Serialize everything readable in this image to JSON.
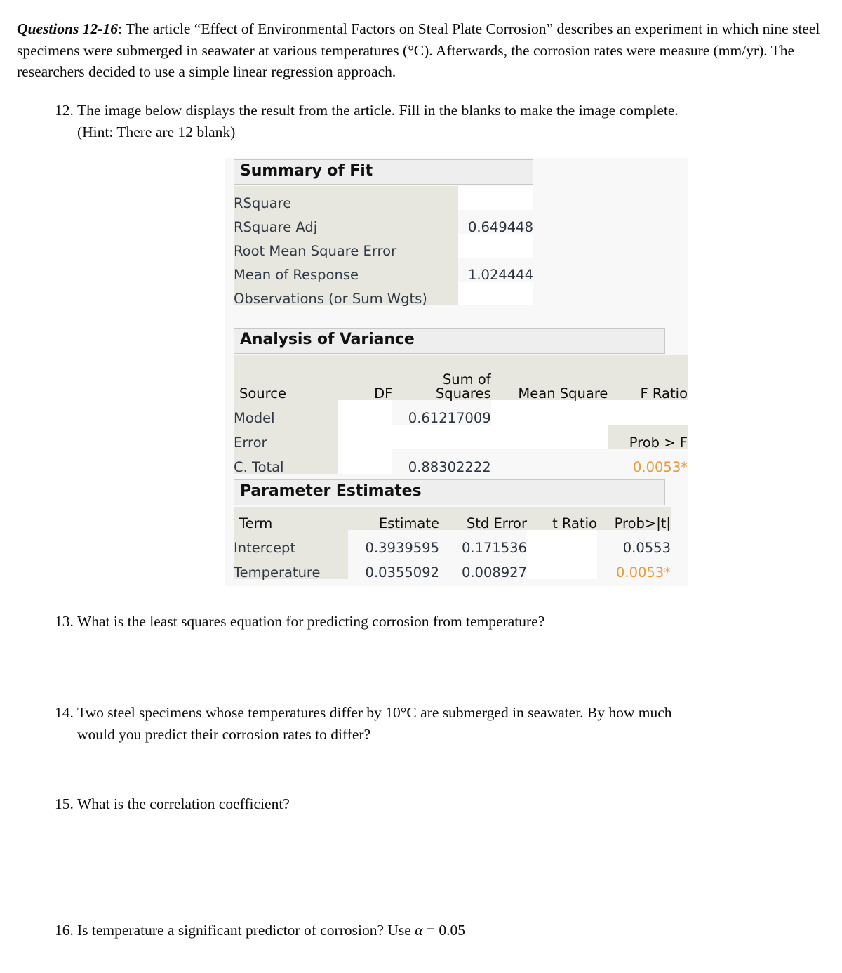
{
  "intro": {
    "lead": "Questions 12-16",
    "text": ": The article “Effect of Environmental Factors on Steal Plate Corrosion” describes an experiment in which nine steel specimens were submerged in seawater at various temperatures (°C). Afterwards, the corrosion rates were measure (mm/yr). The researchers decided to use a simple linear regression approach."
  },
  "questions": [
    {
      "number": "12.",
      "line1": "The image below displays the result from the article. Fill in the blanks to make the image complete.",
      "line2": "(Hint: There are 12 blank)"
    },
    {
      "number": "13.",
      "line1": "What is the least squares equation for predicting corrosion from temperature?",
      "line2": ""
    },
    {
      "number": "14.",
      "line1": "Two steel specimens whose temperatures differ by 10°C are submerged in seawater. By how much",
      "line2": "would you predict their corrosion rates to differ?"
    },
    {
      "number": "15.",
      "line1": "What is the correlation coefficient?",
      "line2": ""
    },
    {
      "number": "16.",
      "line1_pre": "Is temperature a significant predictor of corrosion? Use ",
      "alpha": "α",
      "line1_post": " = 0.05"
    }
  ],
  "report": {
    "colors": {
      "label_bg": "#e7e7e0",
      "header_bg": "#eeeeee",
      "value_text": "#2a3440",
      "significant": "#eb9a37",
      "panel_bg": "#f8f8f8"
    },
    "summary_of_fit": {
      "title": "Summary of Fit",
      "rows": [
        {
          "label": "RSquare",
          "value": ""
        },
        {
          "label": "RSquare Adj",
          "value": "0.649448"
        },
        {
          "label": "Root Mean Square Error",
          "value": ""
        },
        {
          "label": "Mean of Response",
          "value": "1.024444"
        },
        {
          "label": "Observations (or Sum Wgts)",
          "value": ""
        }
      ]
    },
    "analysis_of_variance": {
      "title": "Analysis of Variance",
      "headers": {
        "source": "Source",
        "df": "DF",
        "sum_of": "Sum of",
        "squares": "Squares",
        "mean_square": "Mean Square",
        "f_ratio": "F Ratio",
        "prob_f": "Prob > F"
      },
      "rows": [
        {
          "source": "Model",
          "df": "",
          "sum_of_squares": "0.61217009",
          "mean_square": "",
          "f_ratio": ""
        },
        {
          "source": "Error",
          "df": "",
          "sum_of_squares": "",
          "mean_square": "",
          "f_ratio": ""
        },
        {
          "source": "C. Total",
          "df": "",
          "sum_of_squares": "0.88302222",
          "mean_square": "",
          "f_ratio": ""
        }
      ],
      "prob_f_value": "0.0053*"
    },
    "parameter_estimates": {
      "title": "Parameter Estimates",
      "headers": {
        "term": "Term",
        "estimate": "Estimate",
        "std_error": "Std Error",
        "t_ratio": "t Ratio",
        "prob_t": "Prob>|t|"
      },
      "rows": [
        {
          "term": "Intercept",
          "estimate": "0.3939595",
          "std_error": "0.171536",
          "t_ratio": "",
          "prob_t": "0.0553",
          "significant": false
        },
        {
          "term": "Temperature",
          "estimate": "0.0355092",
          "std_error": "0.008927",
          "t_ratio": "",
          "prob_t": "0.0053*",
          "significant": true
        }
      ]
    }
  }
}
